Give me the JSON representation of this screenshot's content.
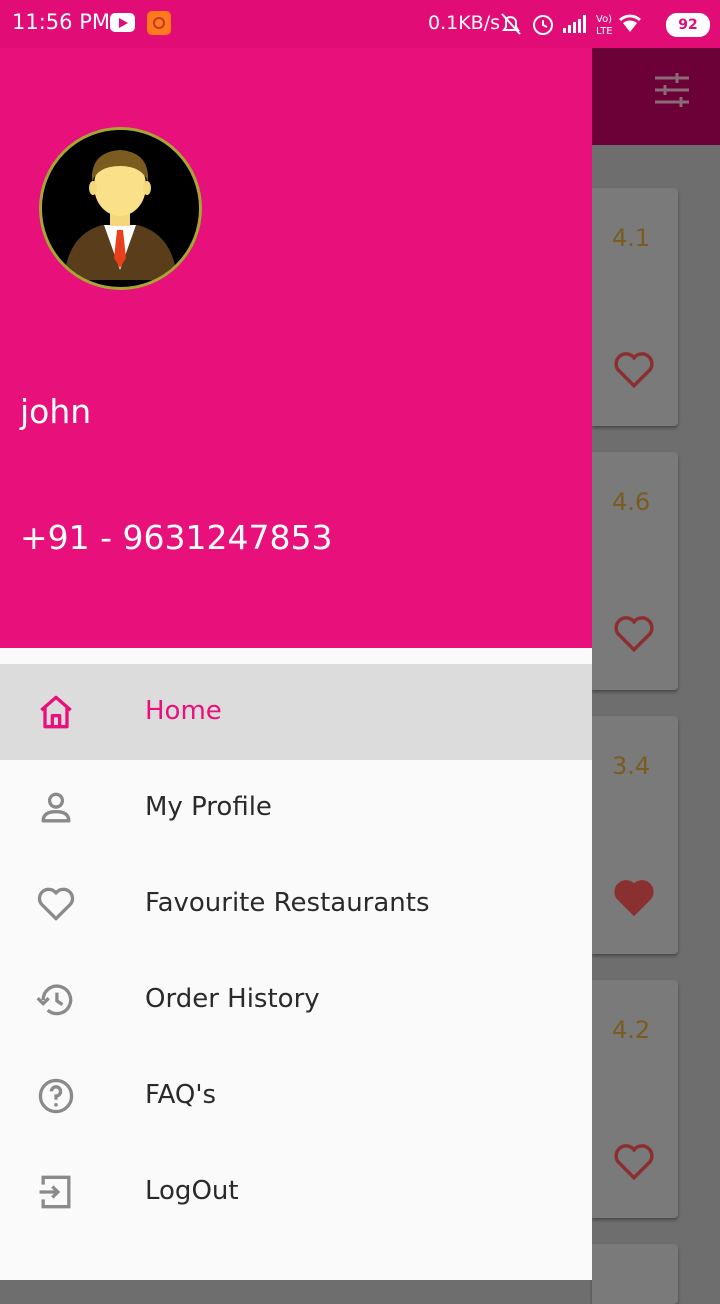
{
  "status_bar": {
    "time": "11:56 PM",
    "net_speed": "0.1KB/s",
    "battery": "92",
    "network": "Vo) LTE"
  },
  "background": {
    "cards": [
      {
        "rating": "4.1",
        "favourite": false
      },
      {
        "rating": "4.6",
        "favourite": false
      },
      {
        "rating": "3.4",
        "favourite": true
      },
      {
        "rating": "4.2",
        "favourite": false
      }
    ]
  },
  "drawer": {
    "user": {
      "name": "john",
      "phone": "+91 - 9631247853"
    },
    "menu": [
      {
        "label": "Home",
        "icon": "home-icon",
        "active": true
      },
      {
        "label": "My Profile",
        "icon": "person-icon",
        "active": false
      },
      {
        "label": "Favourite Restaurants",
        "icon": "heart-icon",
        "active": false
      },
      {
        "label": "Order History",
        "icon": "history-icon",
        "active": false
      },
      {
        "label": "FAQ's",
        "icon": "help-icon",
        "active": false
      },
      {
        "label": "LogOut",
        "icon": "logout-icon",
        "active": false
      }
    ]
  },
  "colors": {
    "primary": "#e8107a",
    "toolbar_dim": "#6b0136",
    "rating": "#7a5c1e",
    "heart": "#8b3030"
  }
}
